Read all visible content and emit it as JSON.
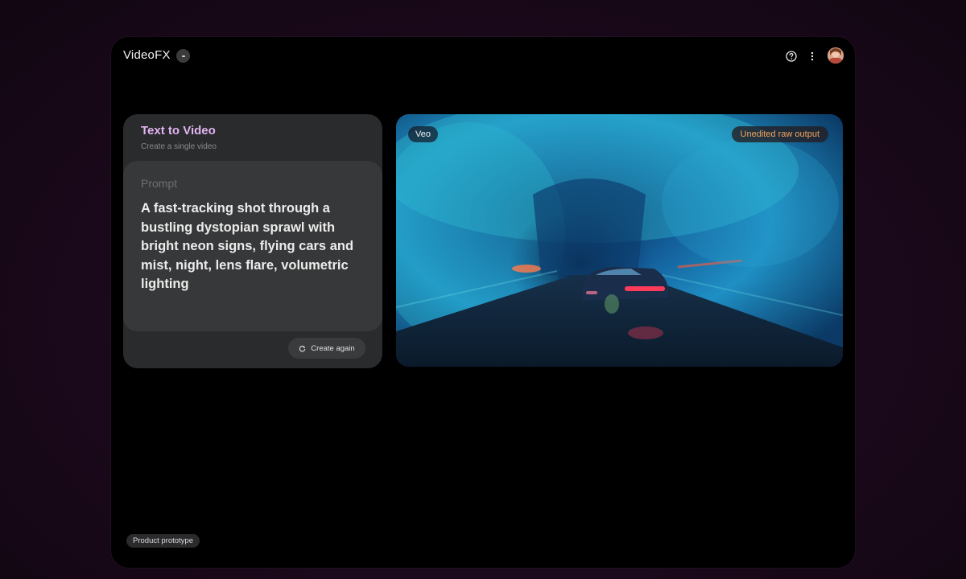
{
  "app": {
    "title": "VideoFX"
  },
  "card": {
    "title": "Text to Video",
    "subtitle": "Create a single video",
    "prompt_label": "Prompt",
    "prompt_text": "A fast-tracking shot through a bustling dystopian sprawl with bright neon signs, flying cars and mist, night, lens flare, volumetric lighting",
    "create_again_label": "Create again"
  },
  "video": {
    "model_tag": "Veo",
    "raw_output_tag": "Unedited raw output"
  },
  "footer": {
    "prototype_tag": "Product prototype"
  },
  "icons": {
    "help": "help-circle-icon",
    "more": "more-vertical-icon",
    "create_again": "refresh-icon",
    "title_badge": "minus-icon"
  },
  "colors": {
    "accent_title": "#e3b4f2",
    "raw_output_text": "#f4a35c",
    "window_bg": "#000000",
    "card_bg": "#2a2b2d"
  }
}
